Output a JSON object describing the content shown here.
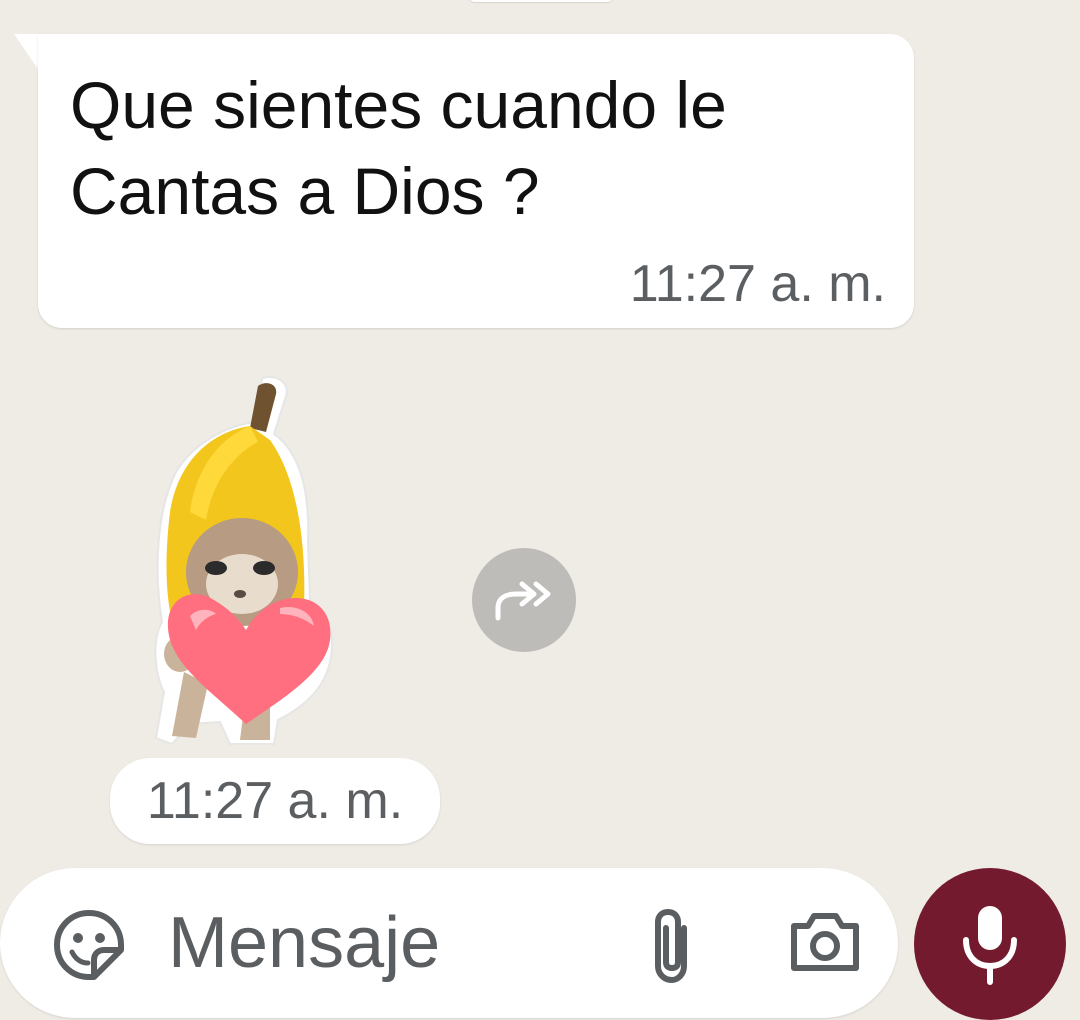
{
  "messages": [
    {
      "type": "text",
      "text": "Que sientes cuando le Cantas a Dios ?",
      "time": "11:27 a. m."
    },
    {
      "type": "sticker",
      "sticker_name": "banana-cat-with-heart",
      "time": "11:27 a. m."
    }
  ],
  "composer": {
    "placeholder": "Mensaje"
  },
  "icons": {
    "emoji": "emoji-sticker-icon",
    "attach": "paperclip-icon",
    "camera": "camera-icon",
    "mic": "microphone-icon",
    "forward": "forward-icon"
  },
  "colors": {
    "background": "#efebe5",
    "bubble": "#ffffff",
    "mic_button": "#731a2e",
    "muted_text": "#5c5f62"
  }
}
